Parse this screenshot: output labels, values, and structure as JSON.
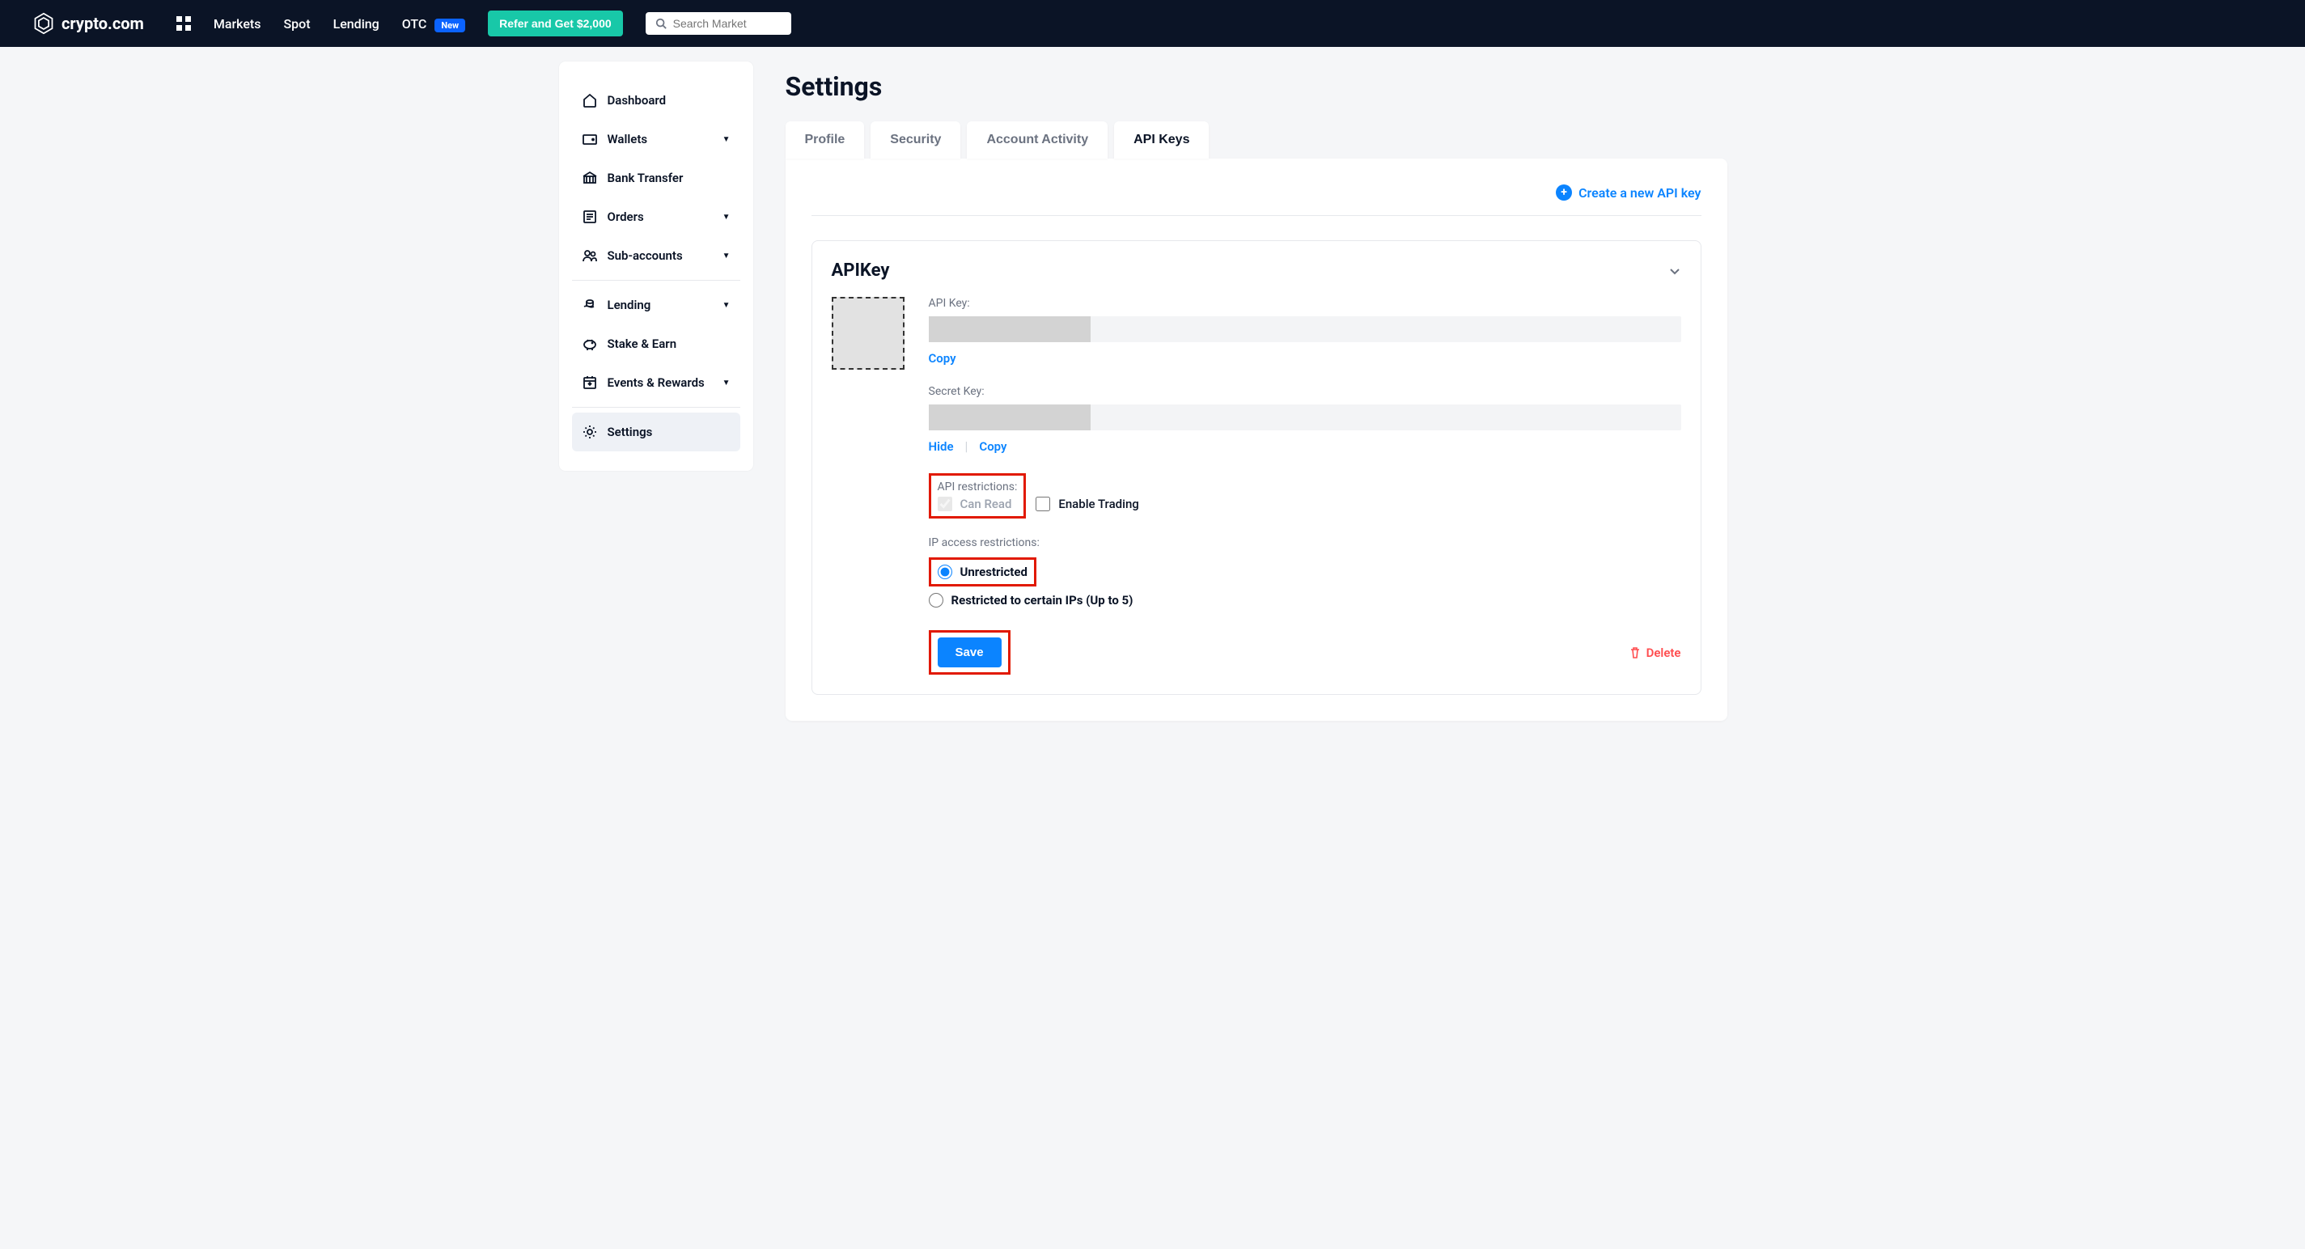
{
  "brand": "crypto.com",
  "topnav": {
    "items": [
      "Markets",
      "Spot",
      "Lending"
    ],
    "otc": "OTC",
    "new_badge": "New",
    "refer_label": "Refer and Get $2,000",
    "search_placeholder": "Search Market"
  },
  "sidebar": {
    "items": [
      {
        "label": "Dashboard",
        "expandable": false
      },
      {
        "label": "Wallets",
        "expandable": true
      },
      {
        "label": "Bank Transfer",
        "expandable": false
      },
      {
        "label": "Orders",
        "expandable": true
      },
      {
        "label": "Sub-accounts",
        "expandable": true
      },
      {
        "label": "Lending",
        "expandable": true
      },
      {
        "label": "Stake & Earn",
        "expandable": false
      },
      {
        "label": "Events & Rewards",
        "expandable": true
      },
      {
        "label": "Settings",
        "expandable": false,
        "active": true
      }
    ]
  },
  "page": {
    "title": "Settings",
    "tabs": [
      "Profile",
      "Security",
      "Account Activity",
      "API Keys"
    ],
    "active_tab": 3,
    "create_label": "Create a new API key",
    "card": {
      "title": "APIKey",
      "api_key_label": "API Key:",
      "secret_key_label": "Secret Key:",
      "copy": "Copy",
      "hide": "Hide",
      "restrictions_label": "API restrictions:",
      "can_read": "Can Read",
      "enable_trading": "Enable Trading",
      "ip_label": "IP access restrictions:",
      "unrestricted": "Unrestricted",
      "restricted": "Restricted to certain IPs (Up to 5)",
      "save": "Save",
      "delete": "Delete"
    }
  },
  "colors": {
    "accent": "#0b84ff",
    "teal": "#18c8a8",
    "danger": "#ff4d4f",
    "highlight_box": "#e11900"
  }
}
